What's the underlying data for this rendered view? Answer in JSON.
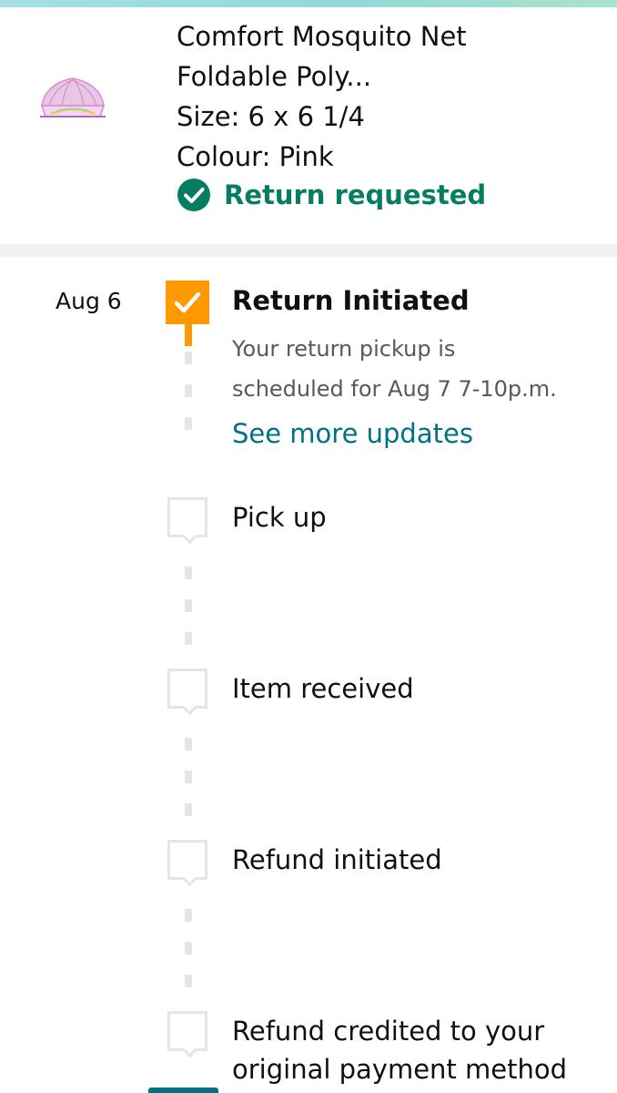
{
  "product": {
    "name_line1": "Comfort Mosquito Net",
    "name_line2": "Foldable Poly...",
    "size": "Size: 6 x 6 1/4",
    "colour": "Colour: Pink",
    "status": "Return requested",
    "status_color": "#067d62",
    "thumbnail_icon": "mosquito-net-image"
  },
  "timeline": {
    "date": "Aug 6",
    "steps": [
      {
        "title": "Return Initiated",
        "completed": true,
        "desc_line1": "Your return pickup is",
        "desc_line2": "scheduled for Aug 7 7-10p.m.",
        "link": "See more updates"
      },
      {
        "title": "Pick up",
        "completed": false
      },
      {
        "title": "Item received",
        "completed": false
      },
      {
        "title": "Refund initiated",
        "completed": false
      },
      {
        "title_line1": "Refund credited to your",
        "title_line2": "original payment method",
        "completed": false
      }
    ]
  },
  "colors": {
    "accent_orange": "#ff9900",
    "link_teal": "#007185",
    "inactive_gray": "#e3e6e6"
  }
}
